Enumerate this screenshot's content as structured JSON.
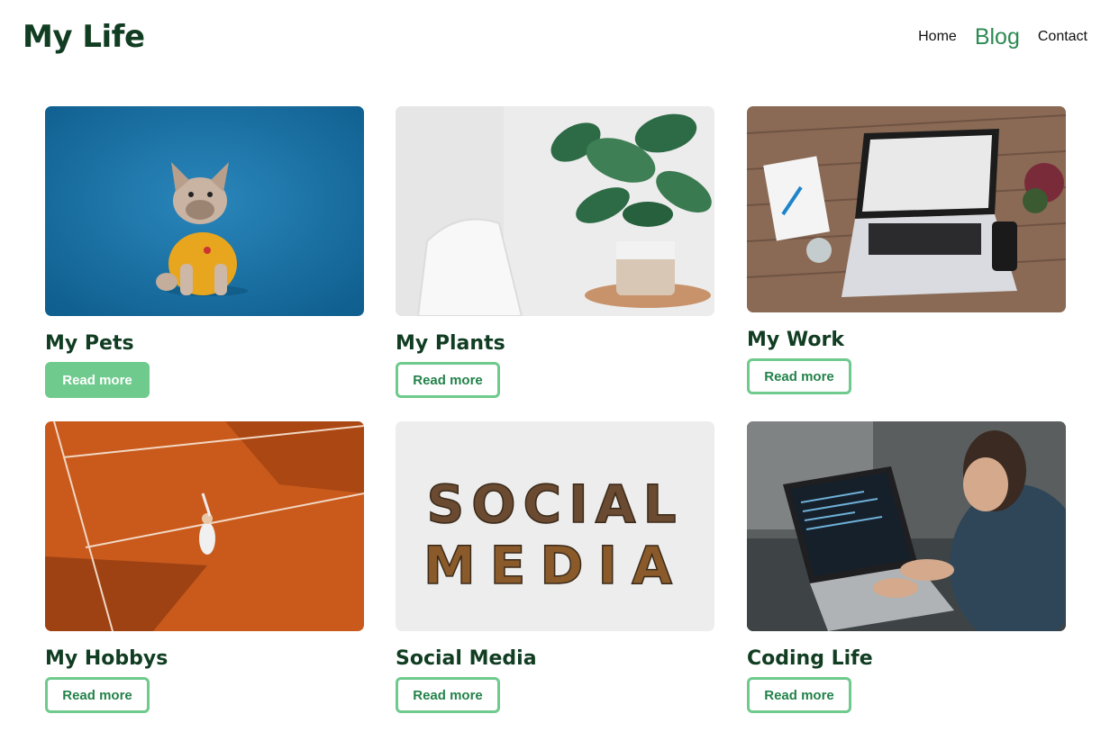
{
  "header": {
    "logo": "My Life",
    "nav": [
      {
        "label": "Home",
        "active": false
      },
      {
        "label": "Blog",
        "active": true
      },
      {
        "label": "Contact",
        "active": false
      }
    ]
  },
  "cards": [
    {
      "title": "My Pets",
      "button": "Read more",
      "image": "french-bulldog-photo",
      "button_style": "filled"
    },
    {
      "title": "My Plants",
      "button": "Read more",
      "image": "potted-plant-photo",
      "button_style": "outline"
    },
    {
      "title": "My Work",
      "button": "Read more",
      "image": "laptop-desk-photo",
      "button_style": "outline"
    },
    {
      "title": "My Hobbys",
      "button": "Read more",
      "image": "tennis-court-photo",
      "button_style": "outline"
    },
    {
      "title": "Social Media",
      "button": "Read more",
      "image": "social-media-letters-photo",
      "button_style": "outline"
    },
    {
      "title": "Coding Life",
      "button": "Read more",
      "image": "man-coding-photo",
      "button_style": "outline"
    }
  ],
  "social_media_image_text": {
    "line1": "SOCIAL",
    "line2": "MEDIA"
  },
  "colors": {
    "brand_dark": "#113d22",
    "accent": "#2c8a52",
    "button_border": "#6fca8d"
  }
}
